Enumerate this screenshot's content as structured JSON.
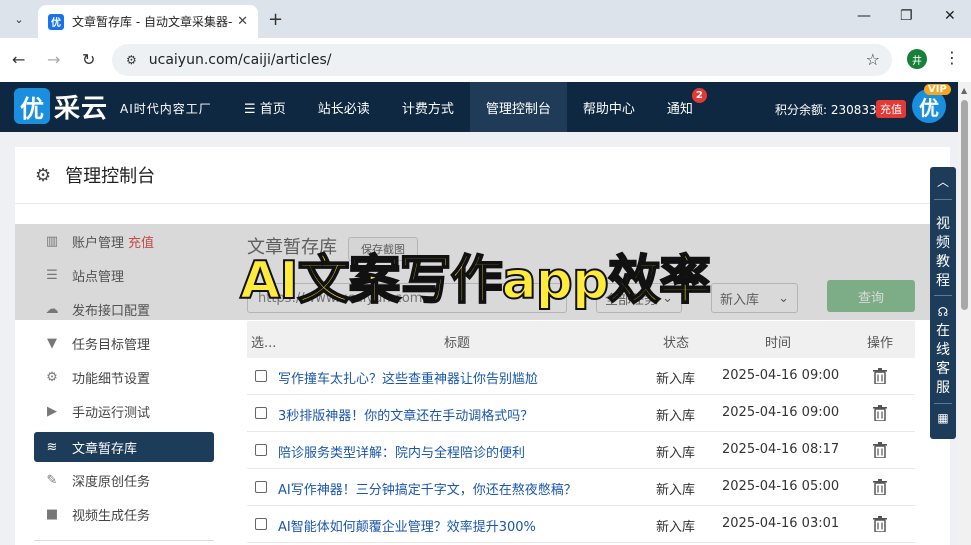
{
  "browser": {
    "tab_title": "文章暂存库 - 自动文章采集器-优",
    "url": "ucaiyun.com/caiji/articles/",
    "favicon_text": "优",
    "extension_text": "井"
  },
  "site": {
    "logo_glyph": "优",
    "logo_text": "采云",
    "slogan": "AI时代内容工厂",
    "nav": [
      {
        "label": "☰ 首页"
      },
      {
        "label": "站长必读"
      },
      {
        "label": "计费方式"
      },
      {
        "label": "管理控制台"
      },
      {
        "label": "帮助中心"
      },
      {
        "label": "通知",
        "badge": "2"
      }
    ],
    "balance": "积分余额: 2308333",
    "recharge": "充值",
    "avatar_glyph": "优",
    "vip": "VIP"
  },
  "card": {
    "title": "管理控制台"
  },
  "overlay": {
    "text": "AI文案写作app效率"
  },
  "sidebar": [
    {
      "label": "账户管理",
      "extra": "充值",
      "icon": "bar-chart-icon"
    },
    {
      "label": "站点管理",
      "icon": "server-icon"
    },
    {
      "label": "发布接口配置",
      "icon": "cloud-upload-icon"
    },
    {
      "label": "任务目标管理",
      "icon": "filter-icon"
    },
    {
      "label": "功能细节设置",
      "icon": "cogs-icon"
    },
    {
      "label": "手动运行测试",
      "icon": "play-icon"
    },
    {
      "label": "文章暂存库",
      "icon": "database-icon",
      "active": true
    },
    {
      "label": "深度原创任务",
      "icon": "edit-icon"
    },
    {
      "label": "视频生成任务",
      "icon": "video-icon"
    }
  ],
  "main": {
    "title": "文章暂存库",
    "save_button": "保存截图",
    "search_placeholder": "https://www.ucaiyun.com",
    "filter_task": "全部任务",
    "filter_status": "新入库",
    "query_button": "查询"
  },
  "table": {
    "headers": [
      "选...",
      "标题",
      "状态",
      "时间",
      "操作"
    ],
    "rows": [
      {
        "title": "写作撞车太扎心？这些查重神器让你告别尴尬",
        "status": "新入库",
        "time": "2025-04-16 09:00"
      },
      {
        "title": "3秒排版神器！你的文章还在手动调格式吗？",
        "status": "新入库",
        "time": "2025-04-16 09:00"
      },
      {
        "title": "陪诊服务类型详解：院内与全程陪诊的便利",
        "status": "新入库",
        "time": "2025-04-16 08:17"
      },
      {
        "title": "AI写作神器！三分钟搞定千字文，你还在熬夜憋稿？",
        "status": "新入库",
        "time": "2025-04-16 05:00"
      },
      {
        "title": "AI智能体如何颠覆企业管理？效率提升300%",
        "status": "新入库",
        "time": "2025-04-16 03:01"
      }
    ]
  },
  "float_panel": {
    "video_tutorial": "视频教程",
    "online_service": "在线客服"
  }
}
